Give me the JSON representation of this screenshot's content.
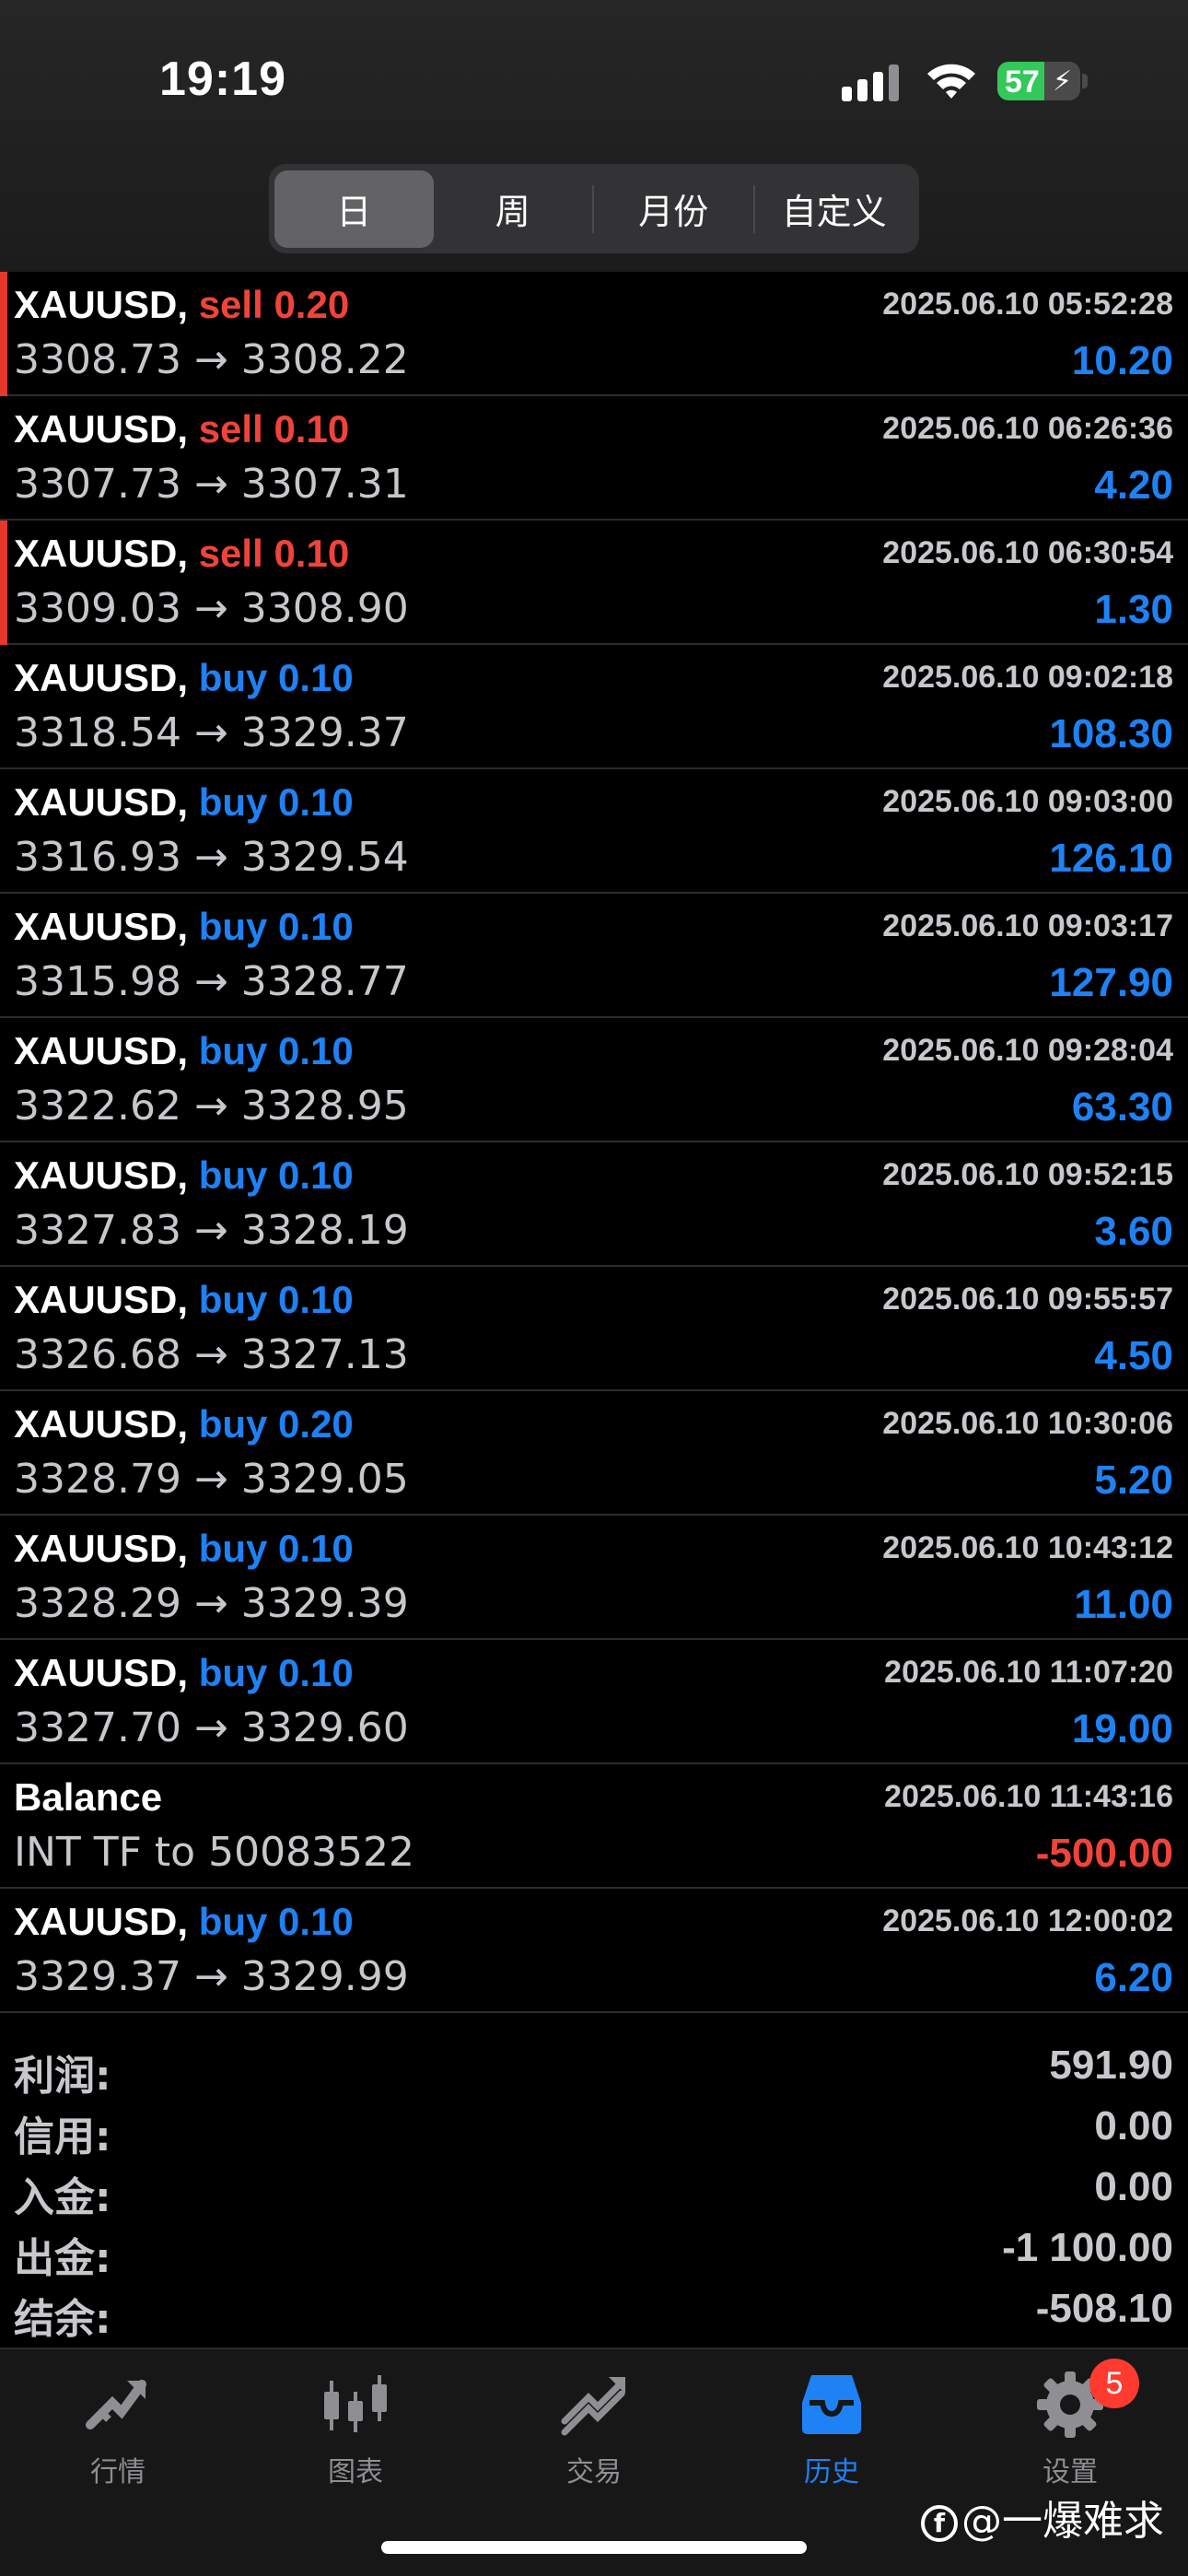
{
  "status_bar": {
    "time": "19:19",
    "battery": "57",
    "battery_level": 0.57
  },
  "tabs": [
    {
      "label": "日",
      "active": true
    },
    {
      "label": "周",
      "active": false
    },
    {
      "label": "月份",
      "active": false
    },
    {
      "label": "自定义",
      "active": false
    }
  ],
  "deals": [
    {
      "symbol": "XAUUSD,",
      "side": "sell",
      "lots": "0.20",
      "time": "2025.06.10 05:52:28",
      "prices": "3308.73 → 3308.22",
      "profit": "10.20",
      "accent": true
    },
    {
      "symbol": "XAUUSD,",
      "side": "sell",
      "lots": "0.10",
      "time": "2025.06.10 06:26:36",
      "prices": "3307.73 → 3307.31",
      "profit": "4.20",
      "accent": false
    },
    {
      "symbol": "XAUUSD,",
      "side": "sell",
      "lots": "0.10",
      "time": "2025.06.10 06:30:54",
      "prices": "3309.03 → 3308.90",
      "profit": "1.30",
      "accent": true
    },
    {
      "symbol": "XAUUSD,",
      "side": "buy",
      "lots": "0.10",
      "time": "2025.06.10 09:02:18",
      "prices": "3318.54 → 3329.37",
      "profit": "108.30",
      "accent": false
    },
    {
      "symbol": "XAUUSD,",
      "side": "buy",
      "lots": "0.10",
      "time": "2025.06.10 09:03:00",
      "prices": "3316.93 → 3329.54",
      "profit": "126.10",
      "accent": false
    },
    {
      "symbol": "XAUUSD,",
      "side": "buy",
      "lots": "0.10",
      "time": "2025.06.10 09:03:17",
      "prices": "3315.98 → 3328.77",
      "profit": "127.90",
      "accent": false
    },
    {
      "symbol": "XAUUSD,",
      "side": "buy",
      "lots": "0.10",
      "time": "2025.06.10 09:28:04",
      "prices": "3322.62 → 3328.95",
      "profit": "63.30",
      "accent": false
    },
    {
      "symbol": "XAUUSD,",
      "side": "buy",
      "lots": "0.10",
      "time": "2025.06.10 09:52:15",
      "prices": "3327.83 → 3328.19",
      "profit": "3.60",
      "accent": false
    },
    {
      "symbol": "XAUUSD,",
      "side": "buy",
      "lots": "0.10",
      "time": "2025.06.10 09:55:57",
      "prices": "3326.68 → 3327.13",
      "profit": "4.50",
      "accent": false
    },
    {
      "symbol": "XAUUSD,",
      "side": "buy",
      "lots": "0.20",
      "time": "2025.06.10 10:30:06",
      "prices": "3328.79 → 3329.05",
      "profit": "5.20",
      "accent": false
    },
    {
      "symbol": "XAUUSD,",
      "side": "buy",
      "lots": "0.10",
      "time": "2025.06.10 10:43:12",
      "prices": "3328.29 → 3329.39",
      "profit": "11.00",
      "accent": false
    },
    {
      "symbol": "XAUUSD,",
      "side": "buy",
      "lots": "0.10",
      "time": "2025.06.10 11:07:20",
      "prices": "3327.70 → 3329.60",
      "profit": "19.00",
      "accent": false
    },
    {
      "symbol": "Balance",
      "side": "",
      "lots": "",
      "time": "2025.06.10 11:43:16",
      "prices": "INT TF to 50083522",
      "profit": "-500.00",
      "accent": false,
      "negative": true
    },
    {
      "symbol": "XAUUSD,",
      "side": "buy",
      "lots": "0.10",
      "time": "2025.06.10 12:00:02",
      "prices": "3329.37 → 3329.99",
      "profit": "6.20",
      "accent": false
    }
  ],
  "summary": [
    {
      "label": "利润:",
      "value": "591.90"
    },
    {
      "label": "信用:",
      "value": "0.00"
    },
    {
      "label": "入金:",
      "value": "0.00"
    },
    {
      "label": "出金:",
      "value": "-1 100.00"
    },
    {
      "label": "结余:",
      "value": "-508.10"
    }
  ],
  "tabbar": [
    {
      "label": "行情",
      "icon": "quotes-icon",
      "active": false
    },
    {
      "label": "图表",
      "icon": "chart-icon",
      "active": false
    },
    {
      "label": "交易",
      "icon": "trade-icon",
      "active": false
    },
    {
      "label": "历史",
      "icon": "history-icon",
      "active": true
    },
    {
      "label": "设置",
      "icon": "settings-icon",
      "active": false
    }
  ],
  "settings_badge": "5",
  "watermark": "@一爆难求",
  "colors": {
    "sell": "#f0443a",
    "buy": "#1e82f5",
    "accent": "#1e82f5",
    "muted": "#8e8e93"
  }
}
